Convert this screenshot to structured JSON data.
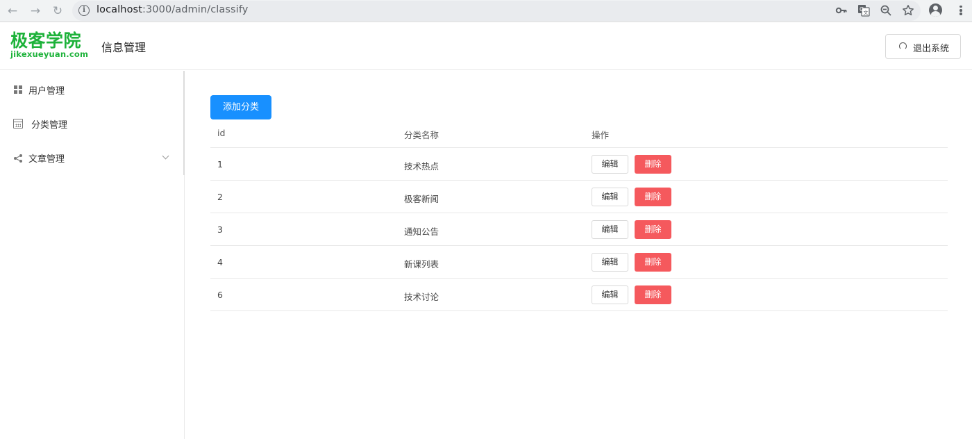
{
  "browser": {
    "back_icon": "←",
    "forward_icon": "→",
    "reload_icon": "↻",
    "url_host": "localhost",
    "url_rest": ":3000/admin/classify"
  },
  "header": {
    "logo_cn": "极客学院",
    "logo_en": "jikexueyuan.com",
    "title": "信息管理",
    "logout_label": "退出系统"
  },
  "sidebar": {
    "items": [
      {
        "label": "用户管理",
        "icon": "grid-icon"
      },
      {
        "label": "分类管理",
        "icon": "calendar-icon"
      },
      {
        "label": "文章管理",
        "icon": "share-icon"
      }
    ]
  },
  "main": {
    "add_button_label": "添加分类",
    "table": {
      "columns": [
        "id",
        "分类名称",
        "操作"
      ],
      "rows": [
        {
          "id": "1",
          "name": "技术热点"
        },
        {
          "id": "2",
          "name": "极客新闻"
        },
        {
          "id": "3",
          "name": "通知公告"
        },
        {
          "id": "4",
          "name": "新课列表"
        },
        {
          "id": "6",
          "name": "技术讨论"
        }
      ],
      "edit_label": "编辑",
      "delete_label": "删除"
    }
  },
  "colors": {
    "brand_green": "#1db23a",
    "primary_blue": "#1890ff",
    "danger_red": "#f5595d"
  }
}
